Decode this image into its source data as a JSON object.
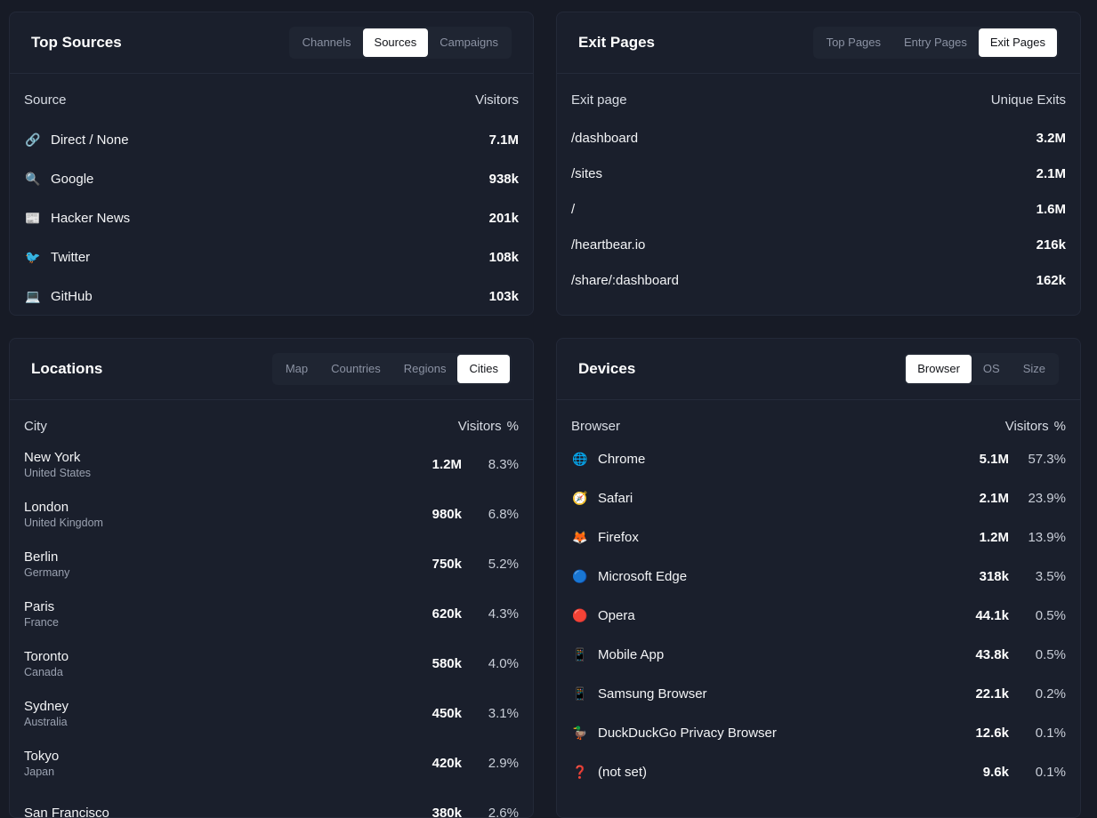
{
  "top_sources": {
    "title": "Top Sources",
    "tabs": [
      "Channels",
      "Sources",
      "Campaigns"
    ],
    "active_tab": "Sources",
    "col_left": "Source",
    "col_right": "Visitors",
    "rows": [
      {
        "icon": "link-icon",
        "glyph": "🔗",
        "label": "Direct / None",
        "value": "7.1M"
      },
      {
        "icon": "magnifier-icon",
        "glyph": "🔍",
        "label": "Google",
        "value": "938k"
      },
      {
        "icon": "newspaper-icon",
        "glyph": "📰",
        "label": "Hacker News",
        "value": "201k"
      },
      {
        "icon": "bird-icon",
        "glyph": "🐦",
        "label": "Twitter",
        "value": "108k"
      },
      {
        "icon": "laptop-icon",
        "glyph": "💻",
        "label": "GitHub",
        "value": "103k"
      }
    ]
  },
  "exit_pages": {
    "title": "Exit Pages",
    "tabs": [
      "Top Pages",
      "Entry Pages",
      "Exit Pages"
    ],
    "active_tab": "Exit Pages",
    "col_left": "Exit page",
    "col_right": "Unique Exits",
    "rows": [
      {
        "label": "/dashboard",
        "value": "3.2M"
      },
      {
        "label": "/sites",
        "value": "2.1M"
      },
      {
        "label": "/",
        "value": "1.6M"
      },
      {
        "label": "/heartbear.io",
        "value": "216k"
      },
      {
        "label": "/share/:dashboard",
        "value": "162k"
      }
    ]
  },
  "locations": {
    "title": "Locations",
    "tabs": [
      "Map",
      "Countries",
      "Regions",
      "Cities"
    ],
    "active_tab": "Cities",
    "col_left": "City",
    "col_right": "Visitors",
    "col_pct": "%",
    "rows": [
      {
        "city": "New York",
        "country": "United States",
        "value": "1.2M",
        "pct": "8.3%"
      },
      {
        "city": "London",
        "country": "United Kingdom",
        "value": "980k",
        "pct": "6.8%"
      },
      {
        "city": "Berlin",
        "country": "Germany",
        "value": "750k",
        "pct": "5.2%"
      },
      {
        "city": "Paris",
        "country": "France",
        "value": "620k",
        "pct": "4.3%"
      },
      {
        "city": "Toronto",
        "country": "Canada",
        "value": "580k",
        "pct": "4.0%"
      },
      {
        "city": "Sydney",
        "country": "Australia",
        "value": "450k",
        "pct": "3.1%"
      },
      {
        "city": "Tokyo",
        "country": "Japan",
        "value": "420k",
        "pct": "2.9%"
      },
      {
        "city": "San Francisco",
        "country": "",
        "value": "380k",
        "pct": "2.6%"
      }
    ]
  },
  "devices": {
    "title": "Devices",
    "tabs": [
      "Browser",
      "OS",
      "Size"
    ],
    "active_tab": "Browser",
    "col_left": "Browser",
    "col_right": "Visitors",
    "col_pct": "%",
    "rows": [
      {
        "icon": "globe-icon",
        "glyph": "🌐",
        "label": "Chrome",
        "value": "5.1M",
        "pct": "57.3%"
      },
      {
        "icon": "compass-icon",
        "glyph": "🧭",
        "label": "Safari",
        "value": "2.1M",
        "pct": "23.9%"
      },
      {
        "icon": "fox-icon",
        "glyph": "🦊",
        "label": "Firefox",
        "value": "1.2M",
        "pct": "13.9%"
      },
      {
        "icon": "blue-circle-icon",
        "glyph": "🔵",
        "label": "Microsoft Edge",
        "value": "318k",
        "pct": "3.5%"
      },
      {
        "icon": "red-circle-icon",
        "glyph": "🔴",
        "label": "Opera",
        "value": "44.1k",
        "pct": "0.5%"
      },
      {
        "icon": "mobile-phone-icon",
        "glyph": "📱",
        "label": "Mobile App",
        "value": "43.8k",
        "pct": "0.5%"
      },
      {
        "icon": "mobile-phone-icon",
        "glyph": "📱",
        "label": "Samsung Browser",
        "value": "22.1k",
        "pct": "0.2%"
      },
      {
        "icon": "duck-icon",
        "glyph": "🦆",
        "label": "DuckDuckGo Privacy Browser",
        "value": "12.6k",
        "pct": "0.1%"
      },
      {
        "icon": "question-mark-icon",
        "glyph": "❓",
        "label": "(not set)",
        "value": "9.6k",
        "pct": "0.1%"
      }
    ]
  }
}
